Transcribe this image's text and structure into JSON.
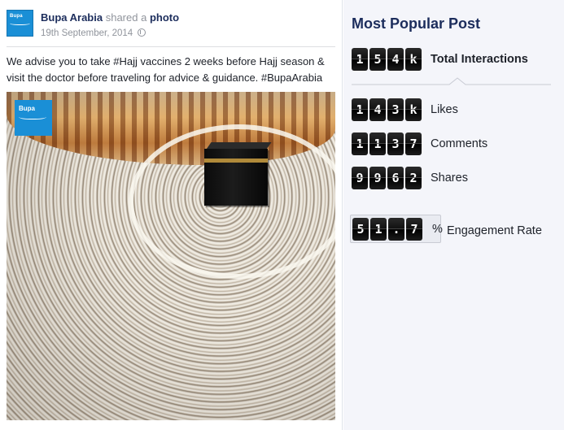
{
  "post": {
    "author": "Bupa Arabia",
    "verb": "shared a",
    "object": "photo",
    "date": "19th September, 2014",
    "caption": "We advise you to take #Hajj vaccines 2 weeks before Hajj season & visit the doctor before traveling for advice & guidance. #BupaArabia",
    "avatar_logo_text": "Bupa",
    "photo_logo_text": "Bupa"
  },
  "panel": {
    "title": "Most Popular Post",
    "total_interactions": {
      "digits": [
        "1",
        "5",
        "4",
        "k"
      ],
      "label": "Total Interactions"
    },
    "likes": {
      "digits": [
        "1",
        "4",
        "3",
        "k"
      ],
      "label": "Likes"
    },
    "comments": {
      "digits": [
        "1",
        "1",
        "3",
        "7"
      ],
      "label": "Comments"
    },
    "shares": {
      "digits": [
        "9",
        "9",
        "6",
        "2"
      ],
      "label": "Shares"
    },
    "engagement": {
      "digits": [
        "5",
        "1",
        ".",
        "7"
      ],
      "unit": "%",
      "label": "Engagement Rate"
    }
  },
  "colors": {
    "brand_navy": "#1c2d5c",
    "bupa_blue": "#1a8fd6",
    "panel_bg": "#f4f5fa",
    "digit_bg": "#111111"
  },
  "icons": {
    "privacy": "globe-icon"
  }
}
